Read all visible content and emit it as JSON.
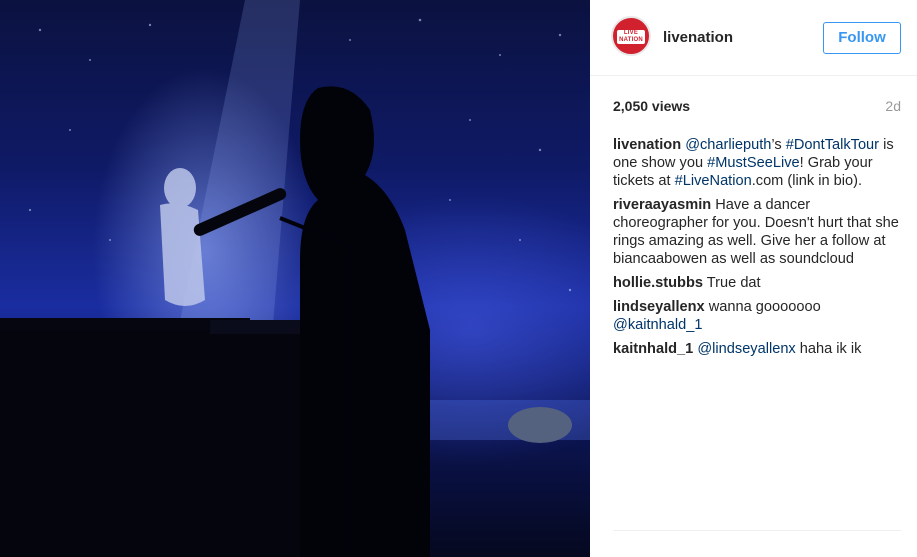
{
  "account": {
    "username": "livenation",
    "avatar_logo_line1": "LIVE",
    "avatar_logo_line2": "NATION",
    "follow_label": "Follow"
  },
  "stats": {
    "views": "2,050 views",
    "age": "2d"
  },
  "caption": {
    "user": "livenation",
    "parts": [
      {
        "type": "mention",
        "text": "@charlieputh"
      },
      {
        "type": "text",
        "text": "’s "
      },
      {
        "type": "hashtag",
        "text": "#DontTalkTour"
      },
      {
        "type": "text",
        "text": " is one show you "
      },
      {
        "type": "hashtag",
        "text": "#MustSeeLive"
      },
      {
        "type": "text",
        "text": "! Grab your tickets at "
      },
      {
        "type": "hashtag",
        "text": "#LiveNation"
      },
      {
        "type": "text",
        "text": ".com (link in bio)."
      }
    ]
  },
  "comments": [
    {
      "user": "riveraayasmin",
      "parts": [
        {
          "type": "text",
          "text": "Have a dancer choreographer for you. Doesn't hurt that she rings amazing as well. Give her a follow at biancaabowen as well as soundcloud"
        }
      ]
    },
    {
      "user": "hollie.stubbs",
      "parts": [
        {
          "type": "text",
          "text": "True dat"
        }
      ]
    },
    {
      "user": "lindseyallenx",
      "parts": [
        {
          "type": "text",
          "text": "wanna gooooooo "
        },
        {
          "type": "mention",
          "text": "@kaitnhald_1"
        }
      ]
    },
    {
      "user": "kaitnhald_1",
      "parts": [
        {
          "type": "mention",
          "text": "@lindseyallenx"
        },
        {
          "type": "text",
          "text": " haha ik ik"
        }
      ]
    }
  ],
  "colors": {
    "accent": "#3897f0",
    "link": "#003569",
    "brand_red": "#d1202e",
    "muted": "#999999",
    "text": "#262626"
  }
}
